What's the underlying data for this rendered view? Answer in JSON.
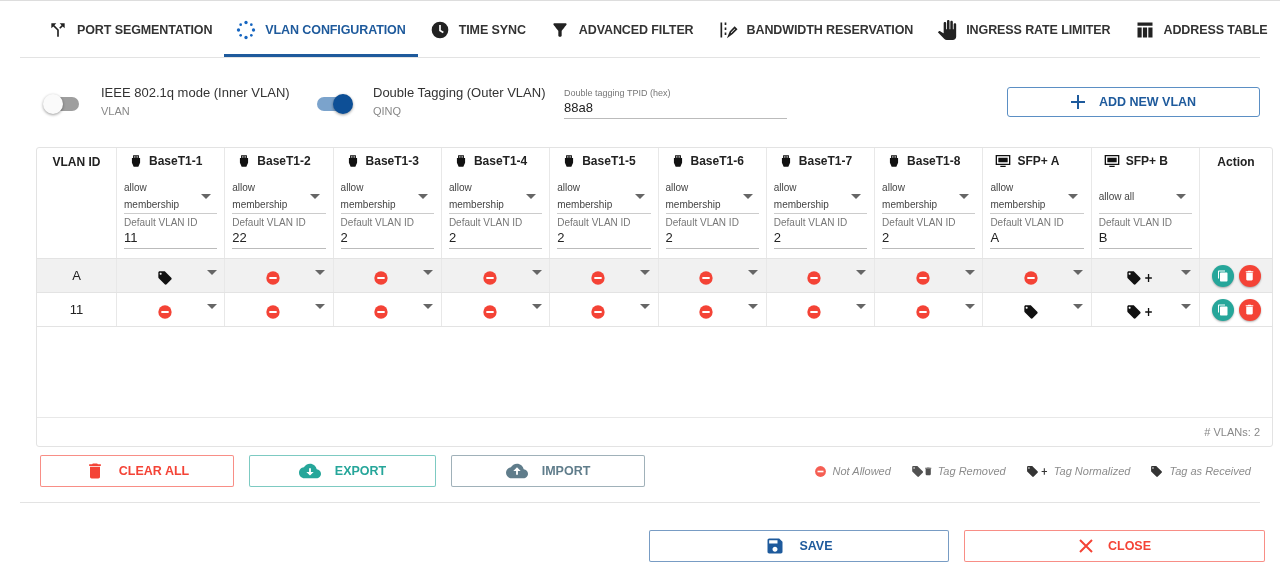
{
  "tabs": [
    {
      "label": "PORT SEGMENTATION",
      "selected": false
    },
    {
      "label": "VLAN CONFIGURATION",
      "selected": true
    },
    {
      "label": "TIME SYNC",
      "selected": false
    },
    {
      "label": "ADVANCED FILTER",
      "selected": false
    },
    {
      "label": "BANDWIDTH RESERVATION",
      "selected": false
    },
    {
      "label": "INGRESS RATE LIMITER",
      "selected": false
    },
    {
      "label": "ADDRESS TABLE",
      "selected": false
    }
  ],
  "modes": [
    {
      "label": "IEEE 802.1q mode (Inner VLAN)",
      "sublabel": "VLAN",
      "on": false
    },
    {
      "label": "Double Tagging (Outer VLAN)",
      "sublabel": "QINQ",
      "on": true
    }
  ],
  "tpid_field": {
    "label": "Double tagging TPID (hex)",
    "value": "88a8"
  },
  "add_button": {
    "label": "ADD NEW VLAN"
  },
  "table": {
    "vlan_id_header": "VLAN ID",
    "action_header": "Action",
    "ports": [
      {
        "name": "BaseT1-1",
        "kind": "baset1",
        "membership": "allow membership",
        "default_label": "Default VLAN ID",
        "default_vlan": "11"
      },
      {
        "name": "BaseT1-2",
        "kind": "baset1",
        "membership": "allow membership",
        "default_label": "Default VLAN ID",
        "default_vlan": "22"
      },
      {
        "name": "BaseT1-3",
        "kind": "baset1",
        "membership": "allow membership",
        "default_label": "Default VLAN ID",
        "default_vlan": "2"
      },
      {
        "name": "BaseT1-4",
        "kind": "baset1",
        "membership": "allow membership",
        "default_label": "Default VLAN ID",
        "default_vlan": "2"
      },
      {
        "name": "BaseT1-5",
        "kind": "baset1",
        "membership": "allow membership",
        "default_label": "Default VLAN ID",
        "default_vlan": "2"
      },
      {
        "name": "BaseT1-6",
        "kind": "baset1",
        "membership": "allow membership",
        "default_label": "Default VLAN ID",
        "default_vlan": "2"
      },
      {
        "name": "BaseT1-7",
        "kind": "baset1",
        "membership": "allow membership",
        "default_label": "Default VLAN ID",
        "default_vlan": "2"
      },
      {
        "name": "BaseT1-8",
        "kind": "baset1",
        "membership": "allow membership",
        "default_label": "Default VLAN ID",
        "default_vlan": "2"
      },
      {
        "name": "SFP+ A",
        "kind": "sfp",
        "membership": "allow membership",
        "default_label": "Default VLAN ID",
        "default_vlan": "A"
      },
      {
        "name": "SFP+ B",
        "kind": "sfp",
        "membership": "allow all",
        "default_label": "Default VLAN ID",
        "default_vlan": "B"
      }
    ],
    "rows": [
      {
        "vlan_id": "A",
        "selected": true,
        "cells": [
          {
            "kind": "tag_as_received"
          },
          {
            "kind": "not_allowed"
          },
          {
            "kind": "not_allowed"
          },
          {
            "kind": "not_allowed"
          },
          {
            "kind": "not_allowed"
          },
          {
            "kind": "not_allowed"
          },
          {
            "kind": "not_allowed"
          },
          {
            "kind": "not_allowed"
          },
          {
            "kind": "not_allowed"
          },
          {
            "kind": "tag_normalized"
          }
        ]
      },
      {
        "vlan_id": "11",
        "selected": false,
        "cells": [
          {
            "kind": "not_allowed"
          },
          {
            "kind": "not_allowed"
          },
          {
            "kind": "not_allowed"
          },
          {
            "kind": "not_allowed"
          },
          {
            "kind": "not_allowed"
          },
          {
            "kind": "not_allowed"
          },
          {
            "kind": "not_allowed"
          },
          {
            "kind": "not_allowed"
          },
          {
            "kind": "tag_as_received"
          },
          {
            "kind": "tag_normalized"
          }
        ]
      }
    ],
    "count": "# VLANs: 2"
  },
  "actions": [
    {
      "kind": "clear",
      "label": "CLEAR ALL"
    },
    {
      "kind": "export",
      "label": "EXPORT"
    },
    {
      "kind": "import",
      "label": "IMPORT"
    }
  ],
  "legend": [
    {
      "kind": "not_allowed",
      "label": "Not Allowed"
    },
    {
      "kind": "tag_removed",
      "label": "Tag Removed"
    },
    {
      "kind": "tag_normalized",
      "label": "Tag Normalized"
    },
    {
      "kind": "tag_as_received",
      "label": "Tag as Received"
    }
  ],
  "footer": [
    {
      "kind": "save",
      "label": "SAVE"
    },
    {
      "kind": "close",
      "label": "CLOSE"
    }
  ]
}
